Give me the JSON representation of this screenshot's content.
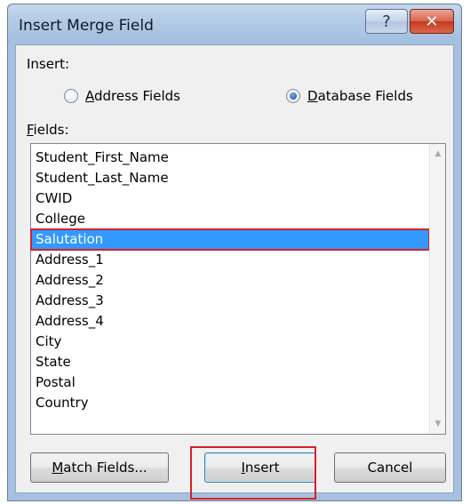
{
  "dialog": {
    "title": "Insert Merge Field",
    "help_glyph": "?",
    "close_glyph": "✕"
  },
  "insert": {
    "label": "Insert:",
    "options": [
      {
        "underlined": "A",
        "rest": "ddress Fields",
        "checked": false
      },
      {
        "underlined": "D",
        "rest": "atabase Fields",
        "checked": true
      }
    ]
  },
  "fields": {
    "label_underlined": "F",
    "label_rest": "ields:",
    "items": [
      "Student_First_Name",
      "Student_Last_Name",
      "CWID",
      "College",
      "Salutation",
      "Address_1",
      "Address_2",
      "Address_3",
      "Address_4",
      "City",
      "State",
      "Postal",
      "Country"
    ],
    "selected_index": 4
  },
  "buttons": {
    "match_underlined": "M",
    "match_rest": "atch Fields...",
    "insert_underlined": "I",
    "insert_rest": "nsert",
    "cancel": "Cancel"
  },
  "colors": {
    "selection": "#3399ff",
    "highlight": "#d4202a",
    "close_button": "#c43a1e"
  }
}
